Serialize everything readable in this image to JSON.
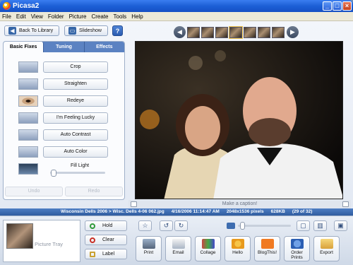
{
  "window": {
    "title": "Picasa2"
  },
  "menu": [
    "File",
    "Edit",
    "View",
    "Folder",
    "Picture",
    "Create",
    "Tools",
    "Help"
  ],
  "nav": {
    "back_label": "Back To Library",
    "slideshow_label": "Slideshow",
    "help_label": "?"
  },
  "tabs": [
    "Basic Fixes",
    "Tuning",
    "Effects"
  ],
  "fixes": [
    "Crop",
    "Straighten",
    "Redeye",
    "I'm Feeling Lucky",
    "Auto Contrast",
    "Auto Color"
  ],
  "fill_light": {
    "label": "Fill Light",
    "level": 0.02
  },
  "undo_label": "Undo",
  "redo_label": "Redo",
  "caption_placeholder": "Make a caption!",
  "status": {
    "path": "Wisconsin Dells 2006 > Wisc. Dells 4-06 062.jpg",
    "datetime": "4/16/2006 11:14:47 AM",
    "dimensions": "2048x1536 pixels",
    "size": "628KB",
    "position": "(29 of 32)"
  },
  "tray": {
    "label": "Picture Tray",
    "hold_label": "Hold",
    "clear_label": "Clear",
    "label_label": "Label"
  },
  "actions": [
    "Print",
    "Email",
    "Collage",
    "Hello",
    "BlogThis!",
    "Order Prints",
    "Export"
  ],
  "colors": {
    "accent": "#2f5c9f",
    "titlebar": "#1c5fd6"
  }
}
